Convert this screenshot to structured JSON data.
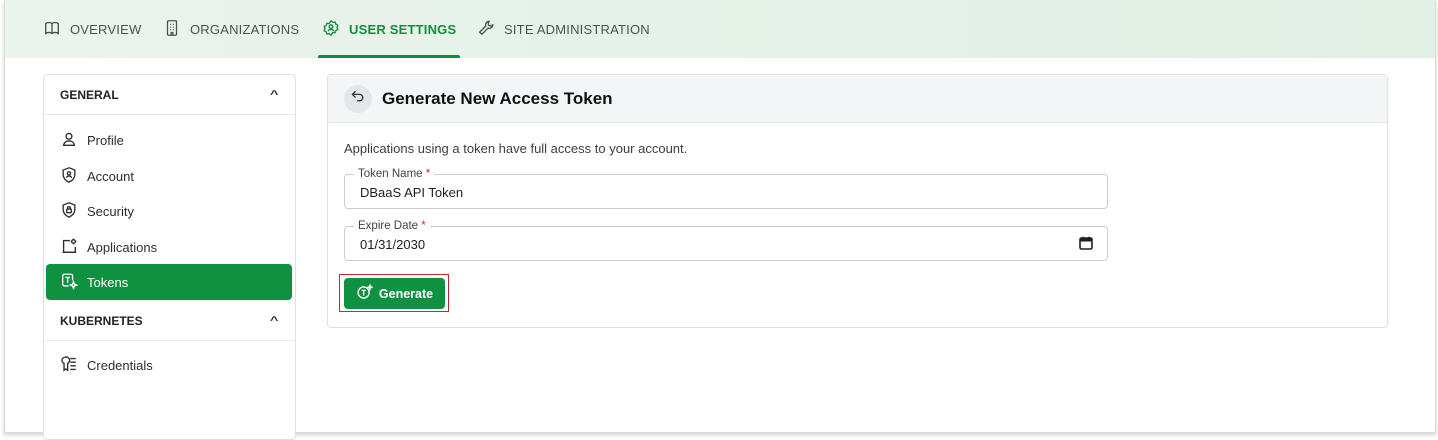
{
  "nav": {
    "tabs": [
      {
        "label": "OVERVIEW",
        "icon": "book-icon"
      },
      {
        "label": "ORGANIZATIONS",
        "icon": "building-icon"
      },
      {
        "label": "USER SETTINGS",
        "icon": "user-settings-icon",
        "active": true
      },
      {
        "label": "SITE ADMINISTRATION",
        "icon": "wrench-icon"
      }
    ]
  },
  "sidebar": {
    "general_title": "GENERAL",
    "general_items": [
      {
        "label": "Profile",
        "icon": "person-icon"
      },
      {
        "label": "Account",
        "icon": "account-shield-icon"
      },
      {
        "label": "Security",
        "icon": "lock-shield-icon"
      },
      {
        "label": "Applications",
        "icon": "applications-icon"
      },
      {
        "label": "Tokens",
        "icon": "token-icon",
        "active": true
      }
    ],
    "kubernetes_title": "KUBERNETES",
    "kubernetes_items": [
      {
        "label": "Credentials",
        "icon": "credentials-icon"
      }
    ]
  },
  "panel": {
    "title": "Generate New Access Token",
    "description": "Applications using a token have full access to your account.",
    "token_name": {
      "label": "Token Name",
      "required_mark": "*",
      "value": "DBaaS API Token"
    },
    "expire_date": {
      "label": "Expire Date",
      "required_mark": "*",
      "value": "01/31/2030"
    },
    "generate_label": "Generate"
  },
  "colors": {
    "accent": "#0f9142",
    "highlight": "#c8272d"
  }
}
